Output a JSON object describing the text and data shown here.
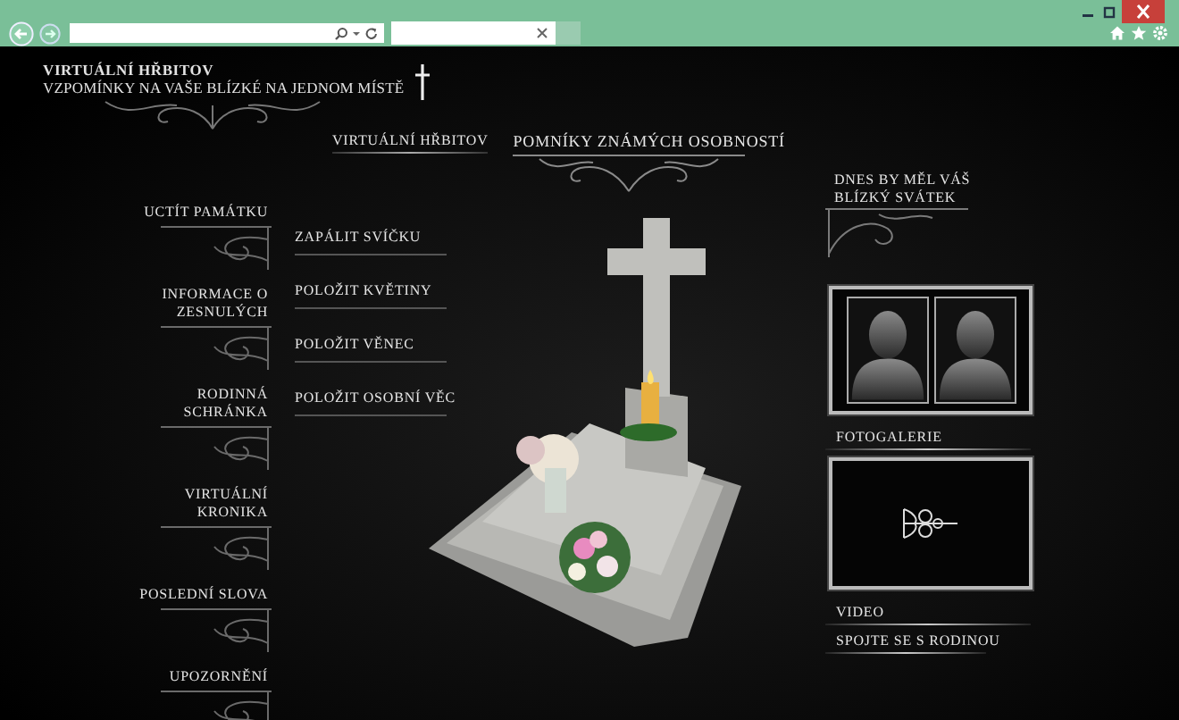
{
  "header": {
    "title": "VIRTUÁLNÍ HŘBITOV",
    "subtitle": "VZPOMÍNKY NA VAŠE BLÍZKÉ NA JEDNOM MÍSTĚ"
  },
  "nav": [
    {
      "label": "VIRTUÁLNÍ HŘBITOV",
      "kind": "plain"
    },
    {
      "label": "POMNÍKY ZNÁMÝCH OSOBNOSTÍ",
      "kind": "ornate"
    }
  ],
  "menu": [
    {
      "lines": [
        "UCTÍT PAMÁTKU"
      ]
    },
    {
      "lines": [
        "INFORMACE O",
        "ZESNULÝCH"
      ]
    },
    {
      "lines": [
        "RODINNÁ",
        "SCHRÁNKA"
      ]
    },
    {
      "lines": [
        "VIRTUÁLNÍ",
        "KRONIKA"
      ]
    },
    {
      "lines": [
        "POSLEDNÍ SLOVA"
      ]
    },
    {
      "lines": [
        "UPOZORNĚNÍ"
      ]
    }
  ],
  "actions": [
    "ZAPÁLIT SVÍČKU",
    "POLOŽIT KVĚTINY",
    "POLOŽIT VĚNEC",
    "POLOŽIT OSOBNÍ VĚC"
  ],
  "sidebar": {
    "holiday": [
      "DNES BY MĚL VÁŠ",
      "BLÍZKÝ SVÁTEK"
    ],
    "gallery_label": "FOTOGALERIE",
    "video_label": "VIDEO",
    "contact_link": "SPOJTE SE S RODINOU"
  }
}
